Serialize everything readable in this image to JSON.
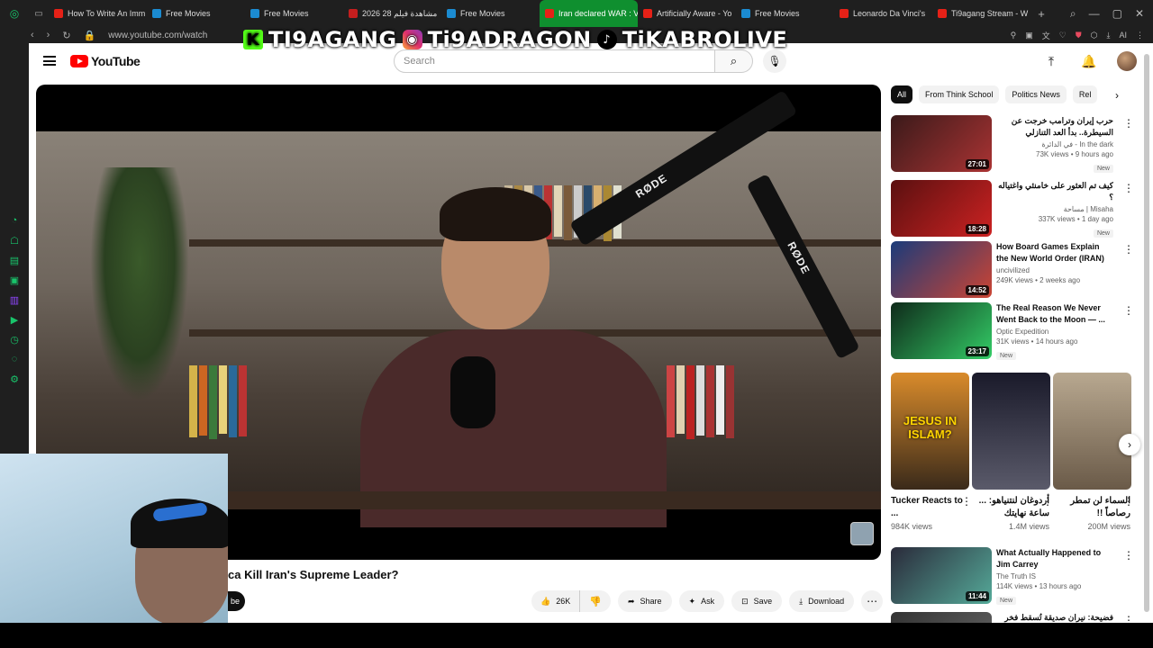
{
  "tabs": [
    {
      "label": "How To Write An Imm",
      "color": "#e62117"
    },
    {
      "label": "Free Movies",
      "color": "#1b8bd1"
    },
    {
      "label": "Free Movies",
      "color": "#1b8bd1"
    },
    {
      "label": "مشاهدة فيلم 28 2026",
      "color": "#c41e1e"
    },
    {
      "label": "Free Movies",
      "color": "#1b8bd1"
    },
    {
      "label": "Iran declared WAR : V",
      "color": "#e62117",
      "active": true
    },
    {
      "label": "Artificially Aware - Yo",
      "color": "#e62117"
    },
    {
      "label": "Free Movies",
      "color": "#1b8bd1"
    },
    {
      "label": "Leonardo Da Vinci's",
      "color": "#e62117"
    },
    {
      "label": "Ti9agang Stream - W",
      "color": "#e62117"
    }
  ],
  "browser": {
    "url": "www.youtube.com/watch",
    "ai_label": "AI"
  },
  "overlay": {
    "kick_handle": "TI9AGANG",
    "instagram_handle": "Ti9ADRAGON",
    "tiktok_handle": "TiKABROLIVE"
  },
  "header": {
    "logo_text": "YouTube",
    "search_placeholder": "Search"
  },
  "video": {
    "title_visible": "ca Kill Iran's Supreme Leader?",
    "subscribe_partial": "be",
    "likes": "26K",
    "share_label": "Share",
    "ask_label": "Ask",
    "save_label": "Save",
    "download_label": "Download"
  },
  "chips": [
    "All",
    "From Think School",
    "Politics News",
    "Rel"
  ],
  "recommendations": [
    {
      "title": "حرب إيران وترامب خرجت عن السيطرة.. بدأ العد التنازلي",
      "channel": "In the dark - في الدائرة",
      "views": "73K views • 9 hours ago",
      "badge": "New",
      "duration": "27:01",
      "rtl": true,
      "thumb": [
        "#3a1a1a",
        "#a33"
      ]
    },
    {
      "title": "كيف تم العثور على خامنئي واغتياله ؟",
      "channel": "Misaha | مساحة",
      "views": "337K views • 1 day ago",
      "badge": "New",
      "duration": "18:28",
      "rtl": true,
      "thumb": [
        "#5a1010",
        "#c22"
      ]
    },
    {
      "title": "How Board Games Explain the New World Order (IRAN)",
      "channel": "uncivilized",
      "views": "249K views • 2 weeks ago",
      "badge": "",
      "duration": "14:52",
      "rtl": false,
      "thumb": [
        "#1b3b7a",
        "#c43"
      ]
    },
    {
      "title": "The Real Reason We Never Went Back to the Moon — ...",
      "channel": "Optic Expedition",
      "views": "31K views • 14 hours ago",
      "badge": "New",
      "duration": "23:17",
      "rtl": false,
      "thumb": [
        "#0f2a1a",
        "#3c6"
      ]
    },
    {
      "title": "What Actually Happened to Jim Carrey",
      "channel": "The Truth IS",
      "views": "114K views • 13 hours ago",
      "badge": "New",
      "duration": "11:44",
      "rtl": false,
      "thumb": [
        "#2a2a3a",
        "#5a9"
      ]
    },
    {
      "title": "فضيحة: نيران صديقة تُسقط فخر أمريكا!",
      "channel": "",
      "views": "",
      "badge": "",
      "duration": "",
      "rtl": true,
      "thumb": [
        "#333",
        "#666"
      ]
    }
  ],
  "shorts": [
    {
      "title": "Tucker Reacts to ...",
      "views": "984K views",
      "rtl": false,
      "thumb": [
        "#d98b2b",
        "#3a2a1a"
      ],
      "caption": "JESUS IN ISLAM?"
    },
    {
      "title": "أردوغان لنتنياهو: ... ساعة نهايتك",
      "views": "1.4M views",
      "rtl": true,
      "thumb": [
        "#1a1a2a",
        "#5a5a6a"
      ],
      "caption": ""
    },
    {
      "title": "السماء لن تمطر رصاصاً !!",
      "views": "200M views",
      "rtl": true,
      "thumb": [
        "#b8a890",
        "#6a5a48"
      ],
      "caption": ""
    }
  ],
  "colors": {
    "youtube_red": "#ff0000",
    "active_tab": "#0f8f2f",
    "sidebar_accent": "#19c46b"
  }
}
